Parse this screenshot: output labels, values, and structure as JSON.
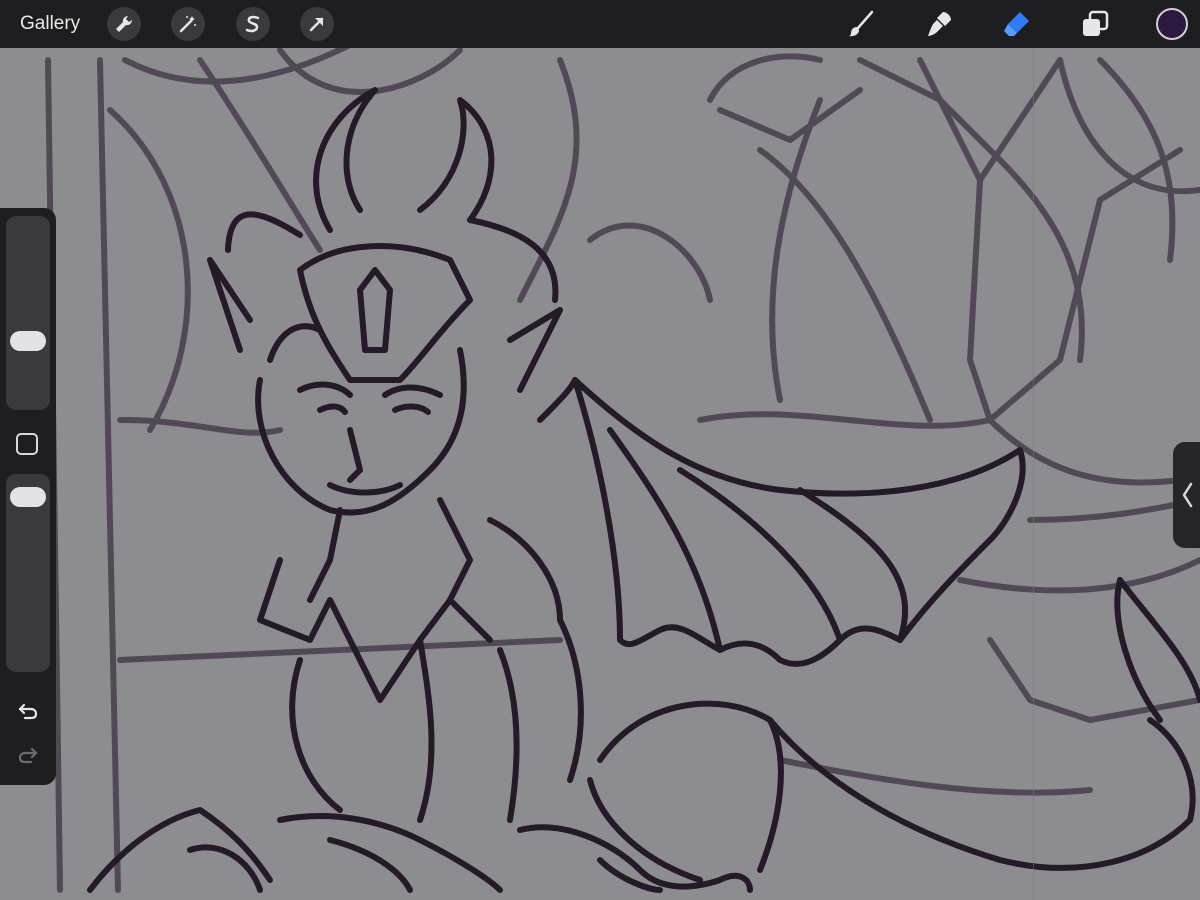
{
  "toolbar": {
    "gallery_label": "Gallery",
    "left_tools": [
      {
        "icon": "wrench-icon",
        "name": "actions"
      },
      {
        "icon": "magic-wand-icon",
        "name": "adjustments"
      },
      {
        "icon": "selection-s-icon",
        "name": "selection"
      },
      {
        "icon": "arrow-cursor-icon",
        "name": "transform"
      }
    ],
    "right_tools": [
      {
        "icon": "brush-icon",
        "name": "paint"
      },
      {
        "icon": "smudge-icon",
        "name": "smudge"
      },
      {
        "icon": "eraser-icon",
        "name": "erase",
        "active": true
      },
      {
        "icon": "layers-icon",
        "name": "layers"
      }
    ],
    "active_color": "#2d1a40",
    "active_tool_color": "#2f7df6"
  },
  "sidebar": {
    "brush_size_level": 0.33,
    "brush_opacity_level": 0.95,
    "undo_icon": "undo-arrow-icon",
    "redo_icon": "redo-arrow-icon",
    "modify_icon": "square-icon"
  },
  "canvas": {
    "background": "#8d8d91",
    "ink_color": "#2b2230"
  },
  "right_handle": {
    "icon": "chevron-left-icon"
  }
}
